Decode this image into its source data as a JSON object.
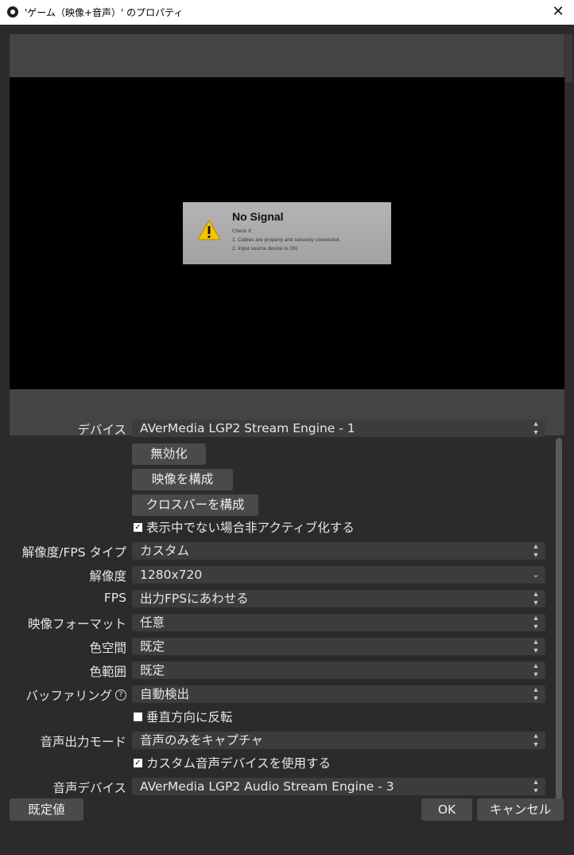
{
  "window": {
    "title": "'ゲーム（映像+音声）' のプロパティ",
    "close_glyph": "✕"
  },
  "preview": {
    "no_signal_title": "No Signal",
    "check_label": "Check if:",
    "line1": "1. Cables are properly and securely connected.",
    "line2": "2. Input source device is ON."
  },
  "properties": {
    "device_label": "デバイス",
    "device_value": "AVerMedia LGP2 Stream Engine - 1",
    "disable_button": "無効化",
    "configure_video_button": "映像を構成",
    "configure_crossbar_button": "クロスバーを構成",
    "deactivate_checkbox": "表示中でない場合非アクティブ化する",
    "res_fps_type_label": "解像度/FPS タイプ",
    "res_fps_type_value": "カスタム",
    "resolution_label": "解像度",
    "resolution_value": "1280x720",
    "fps_label": "FPS",
    "fps_value": "出力FPSにあわせる",
    "video_format_label": "映像フォーマット",
    "video_format_value": "任意",
    "color_space_label": "色空間",
    "color_space_value": "既定",
    "color_range_label": "色範囲",
    "color_range_value": "既定",
    "buffering_label": "バッファリング",
    "buffering_value": "自動検出",
    "flip_vertical_checkbox": "垂直方向に反転",
    "audio_output_mode_label": "音声出力モード",
    "audio_output_mode_value": "音声のみをキャプチャ",
    "custom_audio_checkbox": "カスタム音声デバイスを使用する",
    "audio_device_label": "音声デバイス",
    "audio_device_value": "AVerMedia LGP2 Audio Stream Engine - 3"
  },
  "footer": {
    "defaults_button": "既定値",
    "ok_button": "OK",
    "cancel_button": "キャンセル"
  }
}
